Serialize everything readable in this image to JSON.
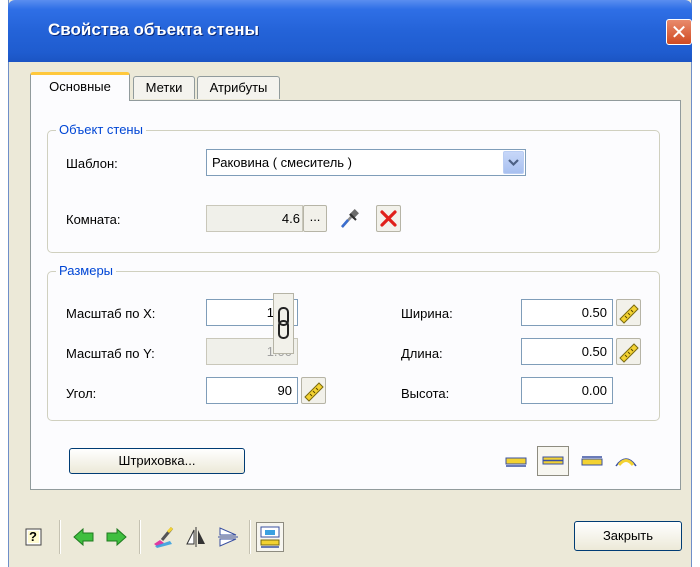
{
  "window": {
    "title": "Свойства объекта стены",
    "close_glyph": "✕"
  },
  "tabs": [
    {
      "label": "Основные",
      "active": true
    },
    {
      "label": "Метки",
      "active": false
    },
    {
      "label": "Атрибуты",
      "active": false
    }
  ],
  "wall_object": {
    "legend": "Объект стены",
    "template_label": "Шаблон:",
    "template_value": "Раковина ( смеситель )",
    "room_label": "Комната:",
    "room_value": "4.6",
    "room_browse_label": "..."
  },
  "dimensions": {
    "legend": "Размеры",
    "scale_x_label": "Масштаб по X:",
    "scale_x_value": "1.00",
    "scale_y_label": "Масштаб по Y:",
    "scale_y_value": "1.00",
    "angle_label": "Угол:",
    "angle_value": "90",
    "width_label": "Ширина:",
    "width_value": "0.50",
    "length_label": "Длина:",
    "length_value": "0.50",
    "height_label": "Высота:",
    "height_value": "0.00"
  },
  "hatch_button_label": "Штриховка...",
  "close_button_label": "Закрыть",
  "colors": {
    "title_bar": "#2463d8",
    "accent_blue": "#0046d5",
    "close_red": "#d04a22",
    "tab_highlight": "#ffc83c",
    "arrow_green": "#2fa43a"
  },
  "icons": {
    "help": "?",
    "eyedropper": "eyedropper-icon",
    "clear": "red-x-icon"
  }
}
